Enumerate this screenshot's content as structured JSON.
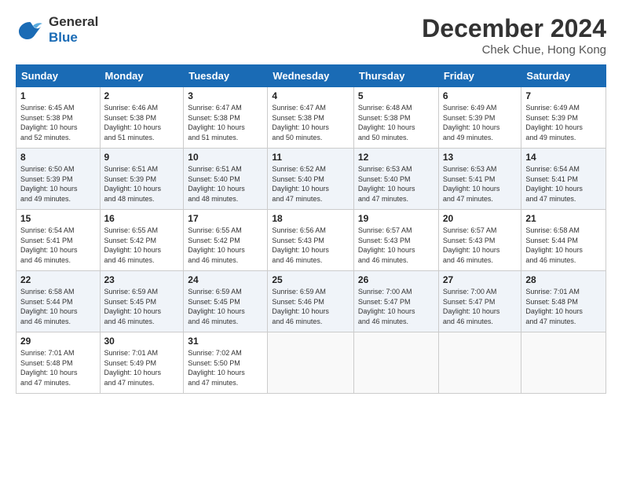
{
  "header": {
    "logo_line1": "General",
    "logo_line2": "Blue",
    "month_title": "December 2024",
    "subtitle": "Chek Chue, Hong Kong"
  },
  "weekdays": [
    "Sunday",
    "Monday",
    "Tuesday",
    "Wednesday",
    "Thursday",
    "Friday",
    "Saturday"
  ],
  "weeks": [
    [
      {
        "day": "1",
        "info": "Sunrise: 6:45 AM\nSunset: 5:38 PM\nDaylight: 10 hours\nand 52 minutes."
      },
      {
        "day": "2",
        "info": "Sunrise: 6:46 AM\nSunset: 5:38 PM\nDaylight: 10 hours\nand 51 minutes."
      },
      {
        "day": "3",
        "info": "Sunrise: 6:47 AM\nSunset: 5:38 PM\nDaylight: 10 hours\nand 51 minutes."
      },
      {
        "day": "4",
        "info": "Sunrise: 6:47 AM\nSunset: 5:38 PM\nDaylight: 10 hours\nand 50 minutes."
      },
      {
        "day": "5",
        "info": "Sunrise: 6:48 AM\nSunset: 5:38 PM\nDaylight: 10 hours\nand 50 minutes."
      },
      {
        "day": "6",
        "info": "Sunrise: 6:49 AM\nSunset: 5:39 PM\nDaylight: 10 hours\nand 49 minutes."
      },
      {
        "day": "7",
        "info": "Sunrise: 6:49 AM\nSunset: 5:39 PM\nDaylight: 10 hours\nand 49 minutes."
      }
    ],
    [
      {
        "day": "8",
        "info": "Sunrise: 6:50 AM\nSunset: 5:39 PM\nDaylight: 10 hours\nand 49 minutes."
      },
      {
        "day": "9",
        "info": "Sunrise: 6:51 AM\nSunset: 5:39 PM\nDaylight: 10 hours\nand 48 minutes."
      },
      {
        "day": "10",
        "info": "Sunrise: 6:51 AM\nSunset: 5:40 PM\nDaylight: 10 hours\nand 48 minutes."
      },
      {
        "day": "11",
        "info": "Sunrise: 6:52 AM\nSunset: 5:40 PM\nDaylight: 10 hours\nand 47 minutes."
      },
      {
        "day": "12",
        "info": "Sunrise: 6:53 AM\nSunset: 5:40 PM\nDaylight: 10 hours\nand 47 minutes."
      },
      {
        "day": "13",
        "info": "Sunrise: 6:53 AM\nSunset: 5:41 PM\nDaylight: 10 hours\nand 47 minutes."
      },
      {
        "day": "14",
        "info": "Sunrise: 6:54 AM\nSunset: 5:41 PM\nDaylight: 10 hours\nand 47 minutes."
      }
    ],
    [
      {
        "day": "15",
        "info": "Sunrise: 6:54 AM\nSunset: 5:41 PM\nDaylight: 10 hours\nand 46 minutes."
      },
      {
        "day": "16",
        "info": "Sunrise: 6:55 AM\nSunset: 5:42 PM\nDaylight: 10 hours\nand 46 minutes."
      },
      {
        "day": "17",
        "info": "Sunrise: 6:55 AM\nSunset: 5:42 PM\nDaylight: 10 hours\nand 46 minutes."
      },
      {
        "day": "18",
        "info": "Sunrise: 6:56 AM\nSunset: 5:43 PM\nDaylight: 10 hours\nand 46 minutes."
      },
      {
        "day": "19",
        "info": "Sunrise: 6:57 AM\nSunset: 5:43 PM\nDaylight: 10 hours\nand 46 minutes."
      },
      {
        "day": "20",
        "info": "Sunrise: 6:57 AM\nSunset: 5:43 PM\nDaylight: 10 hours\nand 46 minutes."
      },
      {
        "day": "21",
        "info": "Sunrise: 6:58 AM\nSunset: 5:44 PM\nDaylight: 10 hours\nand 46 minutes."
      }
    ],
    [
      {
        "day": "22",
        "info": "Sunrise: 6:58 AM\nSunset: 5:44 PM\nDaylight: 10 hours\nand 46 minutes."
      },
      {
        "day": "23",
        "info": "Sunrise: 6:59 AM\nSunset: 5:45 PM\nDaylight: 10 hours\nand 46 minutes."
      },
      {
        "day": "24",
        "info": "Sunrise: 6:59 AM\nSunset: 5:45 PM\nDaylight: 10 hours\nand 46 minutes."
      },
      {
        "day": "25",
        "info": "Sunrise: 6:59 AM\nSunset: 5:46 PM\nDaylight: 10 hours\nand 46 minutes."
      },
      {
        "day": "26",
        "info": "Sunrise: 7:00 AM\nSunset: 5:47 PM\nDaylight: 10 hours\nand 46 minutes."
      },
      {
        "day": "27",
        "info": "Sunrise: 7:00 AM\nSunset: 5:47 PM\nDaylight: 10 hours\nand 46 minutes."
      },
      {
        "day": "28",
        "info": "Sunrise: 7:01 AM\nSunset: 5:48 PM\nDaylight: 10 hours\nand 47 minutes."
      }
    ],
    [
      {
        "day": "29",
        "info": "Sunrise: 7:01 AM\nSunset: 5:48 PM\nDaylight: 10 hours\nand 47 minutes."
      },
      {
        "day": "30",
        "info": "Sunrise: 7:01 AM\nSunset: 5:49 PM\nDaylight: 10 hours\nand 47 minutes."
      },
      {
        "day": "31",
        "info": "Sunrise: 7:02 AM\nSunset: 5:50 PM\nDaylight: 10 hours\nand 47 minutes."
      },
      {
        "day": "",
        "info": ""
      },
      {
        "day": "",
        "info": ""
      },
      {
        "day": "",
        "info": ""
      },
      {
        "day": "",
        "info": ""
      }
    ]
  ]
}
